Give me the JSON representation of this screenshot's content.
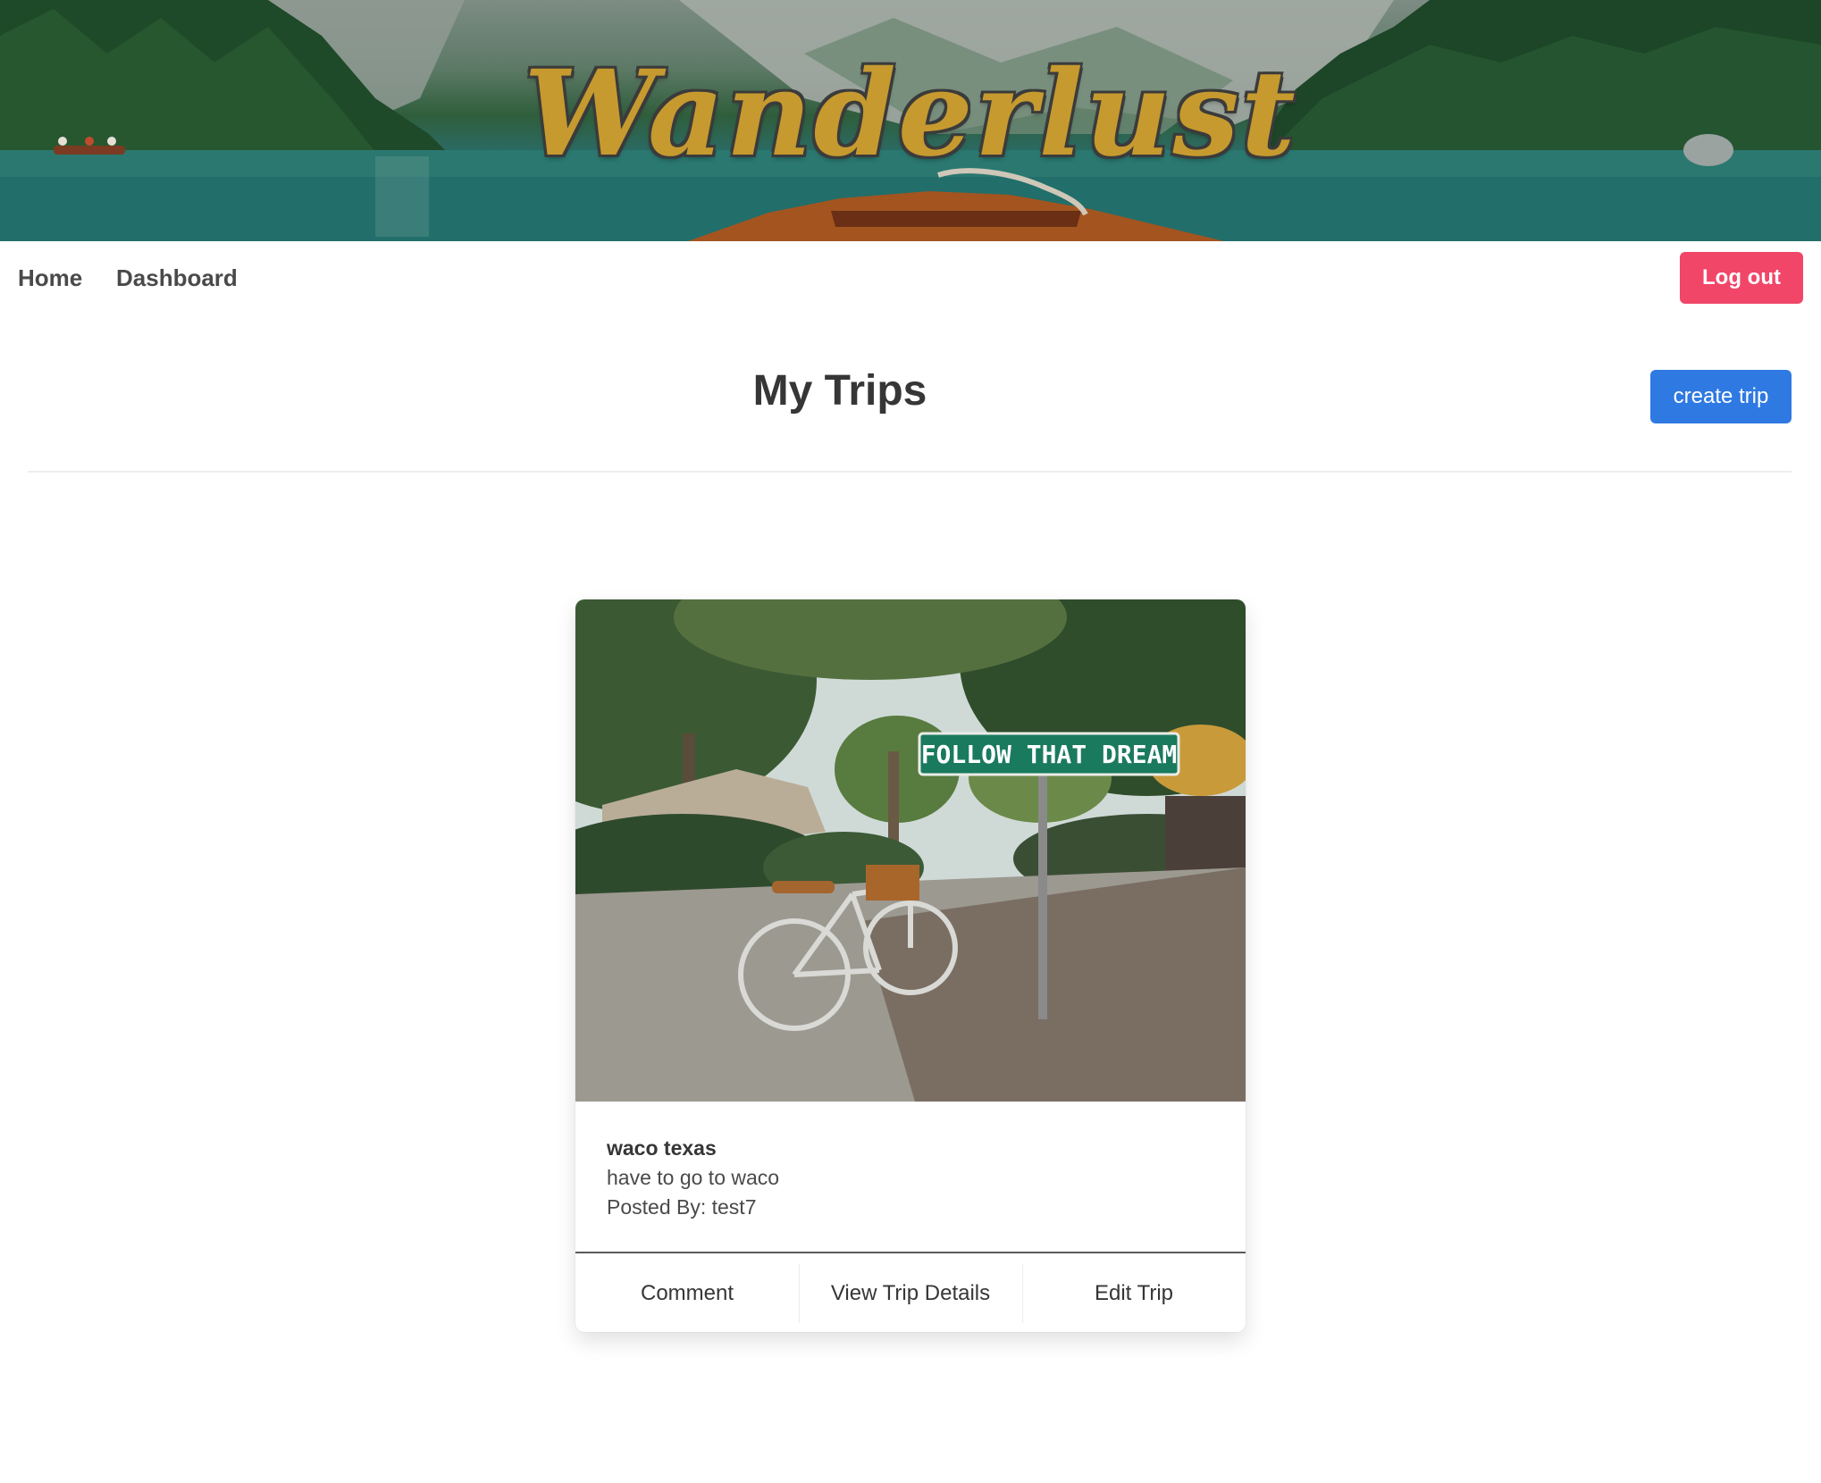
{
  "banner": {
    "logo_text": "Wanderlust"
  },
  "nav": {
    "items": [
      {
        "label": "Home"
      },
      {
        "label": "Dashboard"
      }
    ],
    "logout_label": "Log out"
  },
  "page": {
    "title": "My Trips",
    "create_label": "create trip"
  },
  "trip_card": {
    "image_sign_text": "FOLLOW THAT DREAM",
    "title": "waco texas",
    "description": "have to go to waco",
    "posted_by": "Posted By: test7",
    "actions": [
      {
        "label": "Comment"
      },
      {
        "label": "View Trip Details"
      },
      {
        "label": "Edit Trip"
      }
    ]
  },
  "colors": {
    "logout": "#f14668",
    "primary": "#2f79e2",
    "logo_gold": "#c69a2e"
  }
}
